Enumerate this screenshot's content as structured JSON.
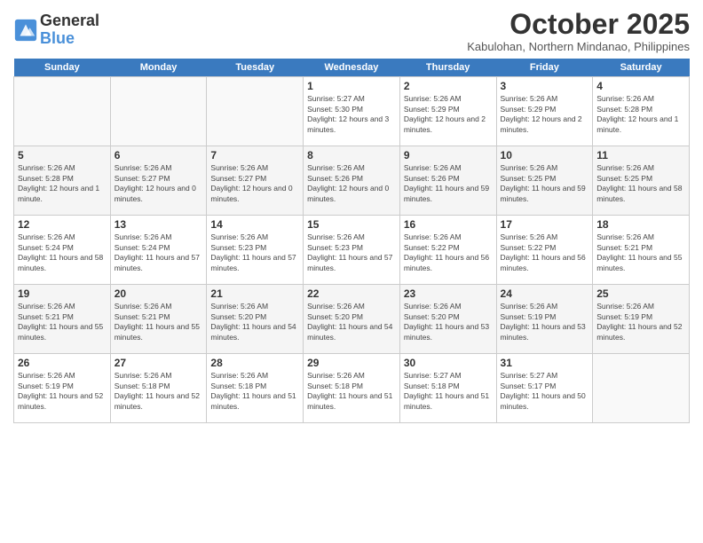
{
  "header": {
    "logo_line1": "General",
    "logo_line2": "Blue",
    "month": "October 2025",
    "location": "Kabulohan, Northern Mindanao, Philippines"
  },
  "days_of_week": [
    "Sunday",
    "Monday",
    "Tuesday",
    "Wednesday",
    "Thursday",
    "Friday",
    "Saturday"
  ],
  "weeks": [
    [
      {
        "day": "",
        "info": ""
      },
      {
        "day": "",
        "info": ""
      },
      {
        "day": "",
        "info": ""
      },
      {
        "day": "1",
        "info": "Sunrise: 5:27 AM\nSunset: 5:30 PM\nDaylight: 12 hours and 3 minutes."
      },
      {
        "day": "2",
        "info": "Sunrise: 5:26 AM\nSunset: 5:29 PM\nDaylight: 12 hours and 2 minutes."
      },
      {
        "day": "3",
        "info": "Sunrise: 5:26 AM\nSunset: 5:29 PM\nDaylight: 12 hours and 2 minutes."
      },
      {
        "day": "4",
        "info": "Sunrise: 5:26 AM\nSunset: 5:28 PM\nDaylight: 12 hours and 1 minute."
      }
    ],
    [
      {
        "day": "5",
        "info": "Sunrise: 5:26 AM\nSunset: 5:28 PM\nDaylight: 12 hours and 1 minute."
      },
      {
        "day": "6",
        "info": "Sunrise: 5:26 AM\nSunset: 5:27 PM\nDaylight: 12 hours and 0 minutes."
      },
      {
        "day": "7",
        "info": "Sunrise: 5:26 AM\nSunset: 5:27 PM\nDaylight: 12 hours and 0 minutes."
      },
      {
        "day": "8",
        "info": "Sunrise: 5:26 AM\nSunset: 5:26 PM\nDaylight: 12 hours and 0 minutes."
      },
      {
        "day": "9",
        "info": "Sunrise: 5:26 AM\nSunset: 5:26 PM\nDaylight: 11 hours and 59 minutes."
      },
      {
        "day": "10",
        "info": "Sunrise: 5:26 AM\nSunset: 5:25 PM\nDaylight: 11 hours and 59 minutes."
      },
      {
        "day": "11",
        "info": "Sunrise: 5:26 AM\nSunset: 5:25 PM\nDaylight: 11 hours and 58 minutes."
      }
    ],
    [
      {
        "day": "12",
        "info": "Sunrise: 5:26 AM\nSunset: 5:24 PM\nDaylight: 11 hours and 58 minutes."
      },
      {
        "day": "13",
        "info": "Sunrise: 5:26 AM\nSunset: 5:24 PM\nDaylight: 11 hours and 57 minutes."
      },
      {
        "day": "14",
        "info": "Sunrise: 5:26 AM\nSunset: 5:23 PM\nDaylight: 11 hours and 57 minutes."
      },
      {
        "day": "15",
        "info": "Sunrise: 5:26 AM\nSunset: 5:23 PM\nDaylight: 11 hours and 57 minutes."
      },
      {
        "day": "16",
        "info": "Sunrise: 5:26 AM\nSunset: 5:22 PM\nDaylight: 11 hours and 56 minutes."
      },
      {
        "day": "17",
        "info": "Sunrise: 5:26 AM\nSunset: 5:22 PM\nDaylight: 11 hours and 56 minutes."
      },
      {
        "day": "18",
        "info": "Sunrise: 5:26 AM\nSunset: 5:21 PM\nDaylight: 11 hours and 55 minutes."
      }
    ],
    [
      {
        "day": "19",
        "info": "Sunrise: 5:26 AM\nSunset: 5:21 PM\nDaylight: 11 hours and 55 minutes."
      },
      {
        "day": "20",
        "info": "Sunrise: 5:26 AM\nSunset: 5:21 PM\nDaylight: 11 hours and 55 minutes."
      },
      {
        "day": "21",
        "info": "Sunrise: 5:26 AM\nSunset: 5:20 PM\nDaylight: 11 hours and 54 minutes."
      },
      {
        "day": "22",
        "info": "Sunrise: 5:26 AM\nSunset: 5:20 PM\nDaylight: 11 hours and 54 minutes."
      },
      {
        "day": "23",
        "info": "Sunrise: 5:26 AM\nSunset: 5:20 PM\nDaylight: 11 hours and 53 minutes."
      },
      {
        "day": "24",
        "info": "Sunrise: 5:26 AM\nSunset: 5:19 PM\nDaylight: 11 hours and 53 minutes."
      },
      {
        "day": "25",
        "info": "Sunrise: 5:26 AM\nSunset: 5:19 PM\nDaylight: 11 hours and 52 minutes."
      }
    ],
    [
      {
        "day": "26",
        "info": "Sunrise: 5:26 AM\nSunset: 5:19 PM\nDaylight: 11 hours and 52 minutes."
      },
      {
        "day": "27",
        "info": "Sunrise: 5:26 AM\nSunset: 5:18 PM\nDaylight: 11 hours and 52 minutes."
      },
      {
        "day": "28",
        "info": "Sunrise: 5:26 AM\nSunset: 5:18 PM\nDaylight: 11 hours and 51 minutes."
      },
      {
        "day": "29",
        "info": "Sunrise: 5:26 AM\nSunset: 5:18 PM\nDaylight: 11 hours and 51 minutes."
      },
      {
        "day": "30",
        "info": "Sunrise: 5:27 AM\nSunset: 5:18 PM\nDaylight: 11 hours and 51 minutes."
      },
      {
        "day": "31",
        "info": "Sunrise: 5:27 AM\nSunset: 5:17 PM\nDaylight: 11 hours and 50 minutes."
      },
      {
        "day": "",
        "info": ""
      }
    ]
  ]
}
